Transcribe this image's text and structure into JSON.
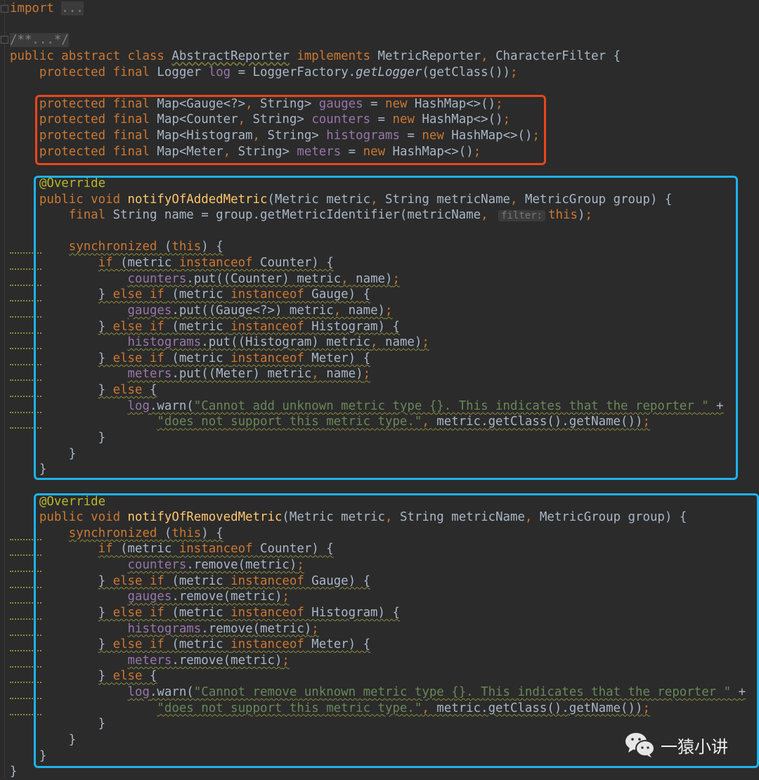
{
  "editor": {
    "theme_background": "#2b2b2b",
    "lines": [
      {
        "tokens": [
          [
            "k",
            "import "
          ],
          [
            "fold",
            "..."
          ]
        ]
      },
      {
        "tokens": []
      },
      {
        "tokens": [
          [
            "c fold",
            "/**...*/"
          ]
        ]
      },
      {
        "tokens": [
          [
            "k",
            "public abstract class "
          ],
          [
            "t u",
            "AbstractReporter"
          ],
          [
            "k",
            " implements "
          ],
          [
            "t",
            "MetricReporter"
          ],
          [
            "k",
            ", "
          ],
          [
            "t",
            "CharacterFilter {"
          ]
        ]
      },
      {
        "tokens": [
          [
            "t",
            "    "
          ],
          [
            "k",
            "protected final "
          ],
          [
            "t",
            "Logger "
          ],
          [
            "f",
            "log"
          ],
          [
            "t",
            " = LoggerFactory."
          ],
          [
            "i",
            "getLogger"
          ],
          [
            "t",
            "(getClass())"
          ],
          [
            "k",
            ";"
          ]
        ]
      },
      {
        "tokens": []
      },
      {
        "tokens": [
          [
            "t",
            "    "
          ],
          [
            "k",
            "protected final "
          ],
          [
            "t",
            "Map<Gauge<?>"
          ],
          [
            "k",
            ", "
          ],
          [
            "t",
            "String> "
          ],
          [
            "f",
            "gauges"
          ],
          [
            "t",
            " = "
          ],
          [
            "k",
            "new "
          ],
          [
            "t",
            "HashMap<>()"
          ],
          [
            "k",
            ";"
          ]
        ]
      },
      {
        "tokens": [
          [
            "t",
            "    "
          ],
          [
            "k",
            "protected final "
          ],
          [
            "t",
            "Map<Counter"
          ],
          [
            "k",
            ", "
          ],
          [
            "t",
            "String> "
          ],
          [
            "f",
            "counters"
          ],
          [
            "t",
            " = "
          ],
          [
            "k",
            "new "
          ],
          [
            "t",
            "HashMap<>()"
          ],
          [
            "k",
            ";"
          ]
        ]
      },
      {
        "tokens": [
          [
            "t",
            "    "
          ],
          [
            "k",
            "protected final "
          ],
          [
            "t",
            "Map<Histogram"
          ],
          [
            "k",
            ", "
          ],
          [
            "t",
            "String> "
          ],
          [
            "f",
            "histograms"
          ],
          [
            "t",
            " = "
          ],
          [
            "k",
            "new "
          ],
          [
            "t",
            "HashMap<>()"
          ],
          [
            "k",
            ";"
          ]
        ]
      },
      {
        "tokens": [
          [
            "t",
            "    "
          ],
          [
            "k",
            "protected final "
          ],
          [
            "t",
            "Map<Meter"
          ],
          [
            "k",
            ", "
          ],
          [
            "t",
            "String> "
          ],
          [
            "f",
            "meters"
          ],
          [
            "t",
            " = "
          ],
          [
            "k",
            "new "
          ],
          [
            "t",
            "HashMap<>()"
          ],
          [
            "k",
            ";"
          ]
        ]
      },
      {
        "tokens": []
      },
      {
        "tokens": [
          [
            "t",
            "    "
          ],
          [
            "a",
            "@Override"
          ]
        ]
      },
      {
        "tokens": [
          [
            "t",
            "    "
          ],
          [
            "k",
            "public void "
          ],
          [
            "m",
            "notifyOfAddedMetric"
          ],
          [
            "t",
            "(Metric metric"
          ],
          [
            "k",
            ", "
          ],
          [
            "t",
            "String metricName"
          ],
          [
            "k",
            ", "
          ],
          [
            "t",
            "MetricGroup group) {"
          ]
        ]
      },
      {
        "tokens": [
          [
            "t",
            "        "
          ],
          [
            "k",
            "final "
          ],
          [
            "t",
            "String name = group.getMetricIdentifier(metricName"
          ],
          [
            "k",
            ", "
          ],
          [
            "h",
            "filter:"
          ],
          [
            "k",
            "this"
          ],
          [
            "t",
            ")"
          ],
          [
            "k",
            ";"
          ]
        ]
      },
      {
        "tokens": []
      },
      {
        "warn": true,
        "tokens": [
          [
            "t",
            "        "
          ],
          [
            "k tok",
            "synchronized"
          ],
          [
            "t tok",
            " ("
          ],
          [
            "k tok",
            "this"
          ],
          [
            "t tok",
            ") {"
          ]
        ]
      },
      {
        "warn": true,
        "tokens": [
          [
            "t",
            "            "
          ],
          [
            "k tok",
            "if"
          ],
          [
            "t tok",
            " (metric "
          ],
          [
            "k tok",
            "instanceof"
          ],
          [
            "t tok",
            " Counter) {"
          ]
        ]
      },
      {
        "warn": true,
        "tokens": [
          [
            "t",
            "                "
          ],
          [
            "f tok",
            "counters"
          ],
          [
            "t tok",
            ".put((Counter) metric"
          ],
          [
            "k tok",
            ", "
          ],
          [
            "t tok",
            "name)"
          ],
          [
            "k tok",
            ";"
          ]
        ]
      },
      {
        "warn": true,
        "tokens": [
          [
            "t",
            "            "
          ],
          [
            "t tok",
            "} "
          ],
          [
            "k tok",
            "else if"
          ],
          [
            "t tok",
            " (metric "
          ],
          [
            "k tok",
            "instanceof"
          ],
          [
            "t tok",
            " Gauge) {"
          ]
        ]
      },
      {
        "warn": true,
        "tokens": [
          [
            "t",
            "                "
          ],
          [
            "f tok",
            "gauges"
          ],
          [
            "t tok",
            ".put((Gauge<?>) metric"
          ],
          [
            "k tok",
            ", "
          ],
          [
            "t tok",
            "name)"
          ],
          [
            "k tok",
            ";"
          ]
        ]
      },
      {
        "warn": true,
        "tokens": [
          [
            "t",
            "            "
          ],
          [
            "t tok",
            "} "
          ],
          [
            "k tok",
            "else if"
          ],
          [
            "t tok",
            " (metric "
          ],
          [
            "k tok",
            "instanceof"
          ],
          [
            "t tok",
            " Histogram) {"
          ]
        ]
      },
      {
        "warn": true,
        "tokens": [
          [
            "t",
            "                "
          ],
          [
            "f tok",
            "histograms"
          ],
          [
            "t tok",
            ".put((Histogram) metric"
          ],
          [
            "k tok",
            ", "
          ],
          [
            "t tok",
            "name)"
          ],
          [
            "k tok",
            ";"
          ]
        ]
      },
      {
        "warn": true,
        "tokens": [
          [
            "t",
            "            "
          ],
          [
            "t tok",
            "} "
          ],
          [
            "k tok",
            "else if"
          ],
          [
            "t tok",
            " (metric "
          ],
          [
            "k tok",
            "instanceof"
          ],
          [
            "t tok",
            " Meter) {"
          ]
        ]
      },
      {
        "warn": true,
        "tokens": [
          [
            "t",
            "                "
          ],
          [
            "f tok",
            "meters"
          ],
          [
            "t tok",
            ".put((Meter) metric"
          ],
          [
            "k tok",
            ", "
          ],
          [
            "t tok",
            "name)"
          ],
          [
            "k tok",
            ";"
          ]
        ]
      },
      {
        "warn": true,
        "tokens": [
          [
            "t",
            "            "
          ],
          [
            "t tok",
            "} "
          ],
          [
            "k tok",
            "else"
          ],
          [
            "t tok",
            " {"
          ]
        ]
      },
      {
        "warn": true,
        "tokens": [
          [
            "t",
            "                "
          ],
          [
            "f tok",
            "log"
          ],
          [
            "t tok",
            ".warn("
          ],
          [
            "s tok",
            "\"Cannot add unknown metric type {}. This indicates that the reporter \""
          ],
          [
            "t tok",
            " +"
          ]
        ]
      },
      {
        "warn": true,
        "tokens": [
          [
            "t",
            "                    "
          ],
          [
            "s tok",
            "\"does not support this metric type.\""
          ],
          [
            "k tok",
            ", "
          ],
          [
            "t tok",
            "metric.getClass().getName())"
          ],
          [
            "k tok",
            ";"
          ]
        ]
      },
      {
        "tokens": [
          [
            "t",
            "            }"
          ]
        ]
      },
      {
        "tokens": [
          [
            "t",
            "        }"
          ]
        ]
      },
      {
        "tokens": [
          [
            "t",
            "    }"
          ]
        ]
      },
      {
        "tokens": []
      },
      {
        "tokens": [
          [
            "t",
            "    "
          ],
          [
            "a",
            "@Override"
          ]
        ]
      },
      {
        "tokens": [
          [
            "t",
            "    "
          ],
          [
            "k",
            "public void "
          ],
          [
            "m",
            "notifyOfRemovedMetric"
          ],
          [
            "t",
            "(Metric metric"
          ],
          [
            "k",
            ", "
          ],
          [
            "t",
            "String metricName"
          ],
          [
            "k",
            ", "
          ],
          [
            "t",
            "MetricGroup group) {"
          ]
        ]
      },
      {
        "warn": true,
        "tokens": [
          [
            "t",
            "        "
          ],
          [
            "k tok",
            "synchronized"
          ],
          [
            "t tok",
            " ("
          ],
          [
            "k tok",
            "this"
          ],
          [
            "t tok",
            ") {"
          ]
        ]
      },
      {
        "warn": true,
        "tokens": [
          [
            "t",
            "            "
          ],
          [
            "k tok",
            "if"
          ],
          [
            "t tok",
            " (metric "
          ],
          [
            "k tok",
            "instanceof"
          ],
          [
            "t tok",
            " Counter) {"
          ]
        ]
      },
      {
        "warn": true,
        "tokens": [
          [
            "t",
            "                "
          ],
          [
            "f tok",
            "counters"
          ],
          [
            "t tok",
            ".remove(metric)"
          ],
          [
            "k tok",
            ";"
          ]
        ]
      },
      {
        "warn": true,
        "tokens": [
          [
            "t",
            "            "
          ],
          [
            "t tok",
            "} "
          ],
          [
            "k tok",
            "else if"
          ],
          [
            "t tok",
            " (metric "
          ],
          [
            "k tok",
            "instanceof"
          ],
          [
            "t tok",
            " Gauge) {"
          ]
        ]
      },
      {
        "warn": true,
        "tokens": [
          [
            "t",
            "                "
          ],
          [
            "f tok",
            "gauges"
          ],
          [
            "t tok",
            ".remove(metric)"
          ],
          [
            "k tok",
            ";"
          ]
        ]
      },
      {
        "warn": true,
        "tokens": [
          [
            "t",
            "            "
          ],
          [
            "t tok",
            "} "
          ],
          [
            "k tok",
            "else if"
          ],
          [
            "t tok",
            " (metric "
          ],
          [
            "k tok",
            "instanceof"
          ],
          [
            "t tok",
            " Histogram) {"
          ]
        ]
      },
      {
        "warn": true,
        "tokens": [
          [
            "t",
            "                "
          ],
          [
            "f tok",
            "histograms"
          ],
          [
            "t tok",
            ".remove(metric)"
          ],
          [
            "k tok",
            ";"
          ]
        ]
      },
      {
        "warn": true,
        "tokens": [
          [
            "t",
            "            "
          ],
          [
            "t tok",
            "} "
          ],
          [
            "k tok",
            "else if"
          ],
          [
            "t tok",
            " (metric "
          ],
          [
            "k tok",
            "instanceof"
          ],
          [
            "t tok",
            " Meter) {"
          ]
        ]
      },
      {
        "warn": true,
        "tokens": [
          [
            "t",
            "                "
          ],
          [
            "f tok",
            "meters"
          ],
          [
            "t tok",
            ".remove(metric)"
          ],
          [
            "k tok",
            ";"
          ]
        ]
      },
      {
        "warn": true,
        "tokens": [
          [
            "t",
            "            "
          ],
          [
            "t tok",
            "} "
          ],
          [
            "k tok",
            "else"
          ],
          [
            "t tok",
            " {"
          ]
        ]
      },
      {
        "warn": true,
        "tokens": [
          [
            "t",
            "                "
          ],
          [
            "f tok",
            "log"
          ],
          [
            "t tok",
            ".warn("
          ],
          [
            "s tok",
            "\"Cannot remove unknown metric type {}. This indicates that the reporter \""
          ],
          [
            "t tok",
            " +"
          ]
        ]
      },
      {
        "warn": true,
        "tokens": [
          [
            "t",
            "                    "
          ],
          [
            "s tok",
            "\"does not support this metric type.\""
          ],
          [
            "k tok",
            ", "
          ],
          [
            "t tok",
            "metric.getClass().getName())"
          ],
          [
            "k tok",
            ";"
          ]
        ]
      },
      {
        "tokens": [
          [
            "t",
            "            }"
          ]
        ]
      },
      {
        "tokens": [
          [
            "t",
            "        }"
          ]
        ]
      },
      {
        "tokens": [
          [
            "t",
            "    }"
          ]
        ]
      },
      {
        "tokens": [
          [
            "t",
            "}"
          ]
        ]
      }
    ]
  },
  "highlights": {
    "fields_color": "#e8461c",
    "methods_color": "#1fb2ec"
  },
  "watermark": {
    "icon": "wechat-icon",
    "text": "一猿小讲"
  }
}
